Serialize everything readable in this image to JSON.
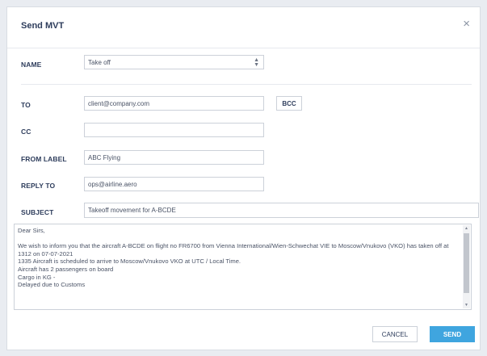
{
  "dialog": {
    "title": "Send MVT",
    "close_icon": "×"
  },
  "form": {
    "name_label": "NAME",
    "name_value": "Take off",
    "to_label": "TO",
    "to_value": "client@company.com",
    "bcc_label": "BCC",
    "cc_label": "CC",
    "cc_value": "",
    "from_label_label": "FROM LABEL",
    "from_label_value": "ABC Flying",
    "reply_to_label": "REPLY TO",
    "reply_to_value": "ops@airline.aero",
    "subject_label": "SUBJECT",
    "subject_value": "Takeoff movement for A-BCDE",
    "body": "Dear Sirs,\n\nWe wish to inform you that the aircraft A-BCDE on flight no FR6700 from Vienna International/Wien-Schwechat VIE to Moscow/Vnukovo (VKO) has taken off at 1312 on 07-07-2021\n1335 Aircraft is scheduled to arrive to Moscow/Vnukovo VKO at  UTC /  Local Time.\nAircraft has 2 passengers on board\nCargo in KG -\nDelayed due to Customs"
  },
  "footer": {
    "cancel_label": "CANCEL",
    "send_label": "SEND"
  },
  "icons": {
    "close": "close-icon",
    "select_arrows": "chevron-up-down-icon",
    "scroll_up": "scroll-up-arrow-icon",
    "scroll_down": "scroll-down-arrow-icon"
  },
  "colors": {
    "label": "#2e3d5c",
    "send_button": "#3fa5df",
    "border": "#ccd1d9"
  }
}
